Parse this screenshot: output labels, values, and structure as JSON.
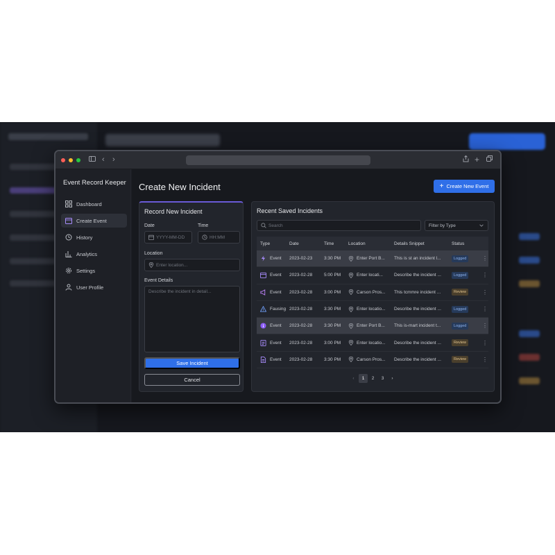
{
  "app": {
    "title": "Event Record Keeper"
  },
  "sidebar": {
    "items": [
      {
        "label": "Dashboard",
        "icon": "dashboard-icon"
      },
      {
        "label": "Create Event",
        "icon": "calendar-icon",
        "active": true
      },
      {
        "label": "History",
        "icon": "history-icon"
      },
      {
        "label": "Analytics",
        "icon": "analytics-icon"
      },
      {
        "label": "Settings",
        "icon": "gear-icon"
      },
      {
        "label": "User Profile",
        "icon": "user-icon"
      }
    ]
  },
  "header": {
    "title": "Create New Incident",
    "create_button": "Create New Event"
  },
  "form": {
    "title": "Record New Incident",
    "date_label": "Date",
    "date_placeholder": "YYYY-MM-DD",
    "time_label": "Time",
    "time_placeholder": "HH:MM",
    "location_label": "Location",
    "location_placeholder": "Enter location...",
    "details_label": "Event Details",
    "details_placeholder": "Describe the incident in detail...",
    "save_button": "Save Incident",
    "cancel_button": "Cancel"
  },
  "recent": {
    "title": "Recent Saved Incidents",
    "search_placeholder": "Search",
    "filter_label": "Filter by Type",
    "columns": [
      "Type",
      "Date",
      "Time",
      "Location",
      "Details Snippet",
      "Status"
    ],
    "rows": [
      {
        "type": "Event",
        "icon": "lightning-icon",
        "date": "2023-02-23",
        "time": "3:30 PM",
        "location": "Enter Port B...",
        "details": "This is st an incident l...",
        "status": "Logged",
        "highlight": true
      },
      {
        "type": "Event",
        "icon": "calendar-icon",
        "date": "2023-02-28",
        "time": "5:00 PM",
        "location": "Enter locati...",
        "details": "Describe the incident ...",
        "status": "Logged",
        "highlight": false
      },
      {
        "type": "Event",
        "icon": "megaphone-icon",
        "date": "2023-02-28",
        "time": "3:00 PM",
        "location": "Carson Pros...",
        "details": "This tcmmre incident ...",
        "status": "Review",
        "highlight": false
      },
      {
        "type": "Fausing",
        "icon": "warning-icon",
        "date": "2023-02-28",
        "time": "3:30 PM",
        "location": "Enter locatio...",
        "details": "Describe the incident ...",
        "status": "Logged",
        "highlight": false
      },
      {
        "type": "Event",
        "icon": "info-icon",
        "date": "2023-02-28",
        "time": "3:30 PM",
        "location": "Enter Port B...",
        "details": "This is-mart incident t...",
        "status": "Logged",
        "highlight": true
      },
      {
        "type": "Event",
        "icon": "form-icon",
        "date": "2023-02-28",
        "time": "3:00 PM",
        "location": "Enter locatio...",
        "details": "Describe the incident ...",
        "status": "Review",
        "highlight": false
      },
      {
        "type": "Event",
        "icon": "document-icon",
        "date": "2023-02-28",
        "time": "3:30 PM",
        "location": "Carson Pros...",
        "details": "Describe the incident ...",
        "status": "Review",
        "highlight": false
      }
    ],
    "pagination": {
      "prev": "‹",
      "pages": [
        "1",
        "2",
        "3"
      ],
      "current": "1",
      "next": "›"
    }
  },
  "colors": {
    "accent": "#2f6fe8",
    "background": "#17191e",
    "panel": "#22252c",
    "logged": "#8fb4ef",
    "review": "#e3c48e"
  }
}
